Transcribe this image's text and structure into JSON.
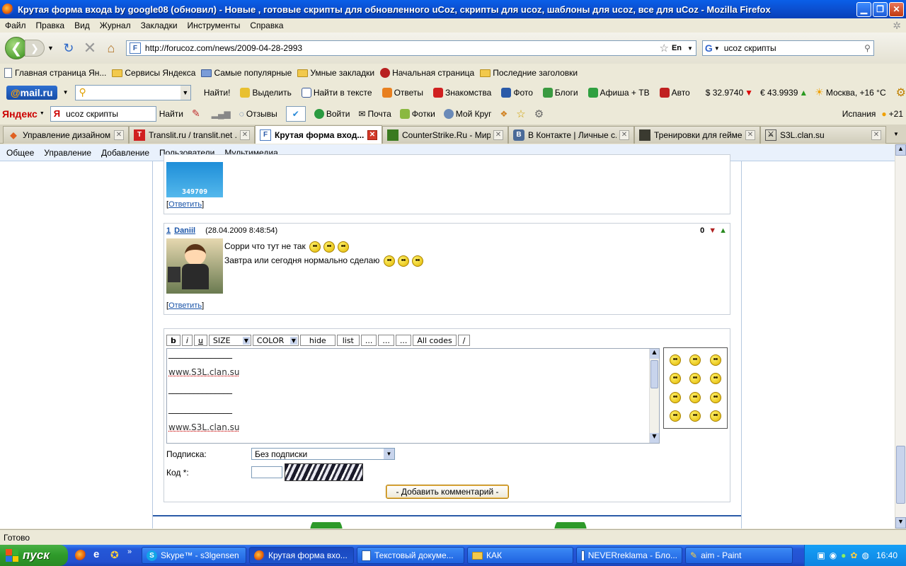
{
  "window": {
    "title": "Крутая форма входа by google08 (обновил) - Новые , готовые скрипты для обновленного uCoz, скрипты для ucoz, шаблоны для ucoz, все для uCoz - Mozilla Firefox"
  },
  "menu": [
    "Файл",
    "Правка",
    "Вид",
    "Журнал",
    "Закладки",
    "Инструменты",
    "Справка"
  ],
  "nav": {
    "url": "http://forucoz.com/news/2009-04-28-2993",
    "lang_badge": "En",
    "search_value": "ucoz скрипты"
  },
  "bookmarks": [
    "Главная страница Ян...",
    "Сервисы Яндекса",
    "Самые популярные",
    "Умные закладки",
    "Начальная страница",
    "Последние заголовки"
  ],
  "mailbar": {
    "logo_prefix": "@",
    "logo_text": "mail.ru",
    "find_label": "Найти!",
    "items": [
      "Выделить",
      "Найти в тексте",
      "Ответы",
      "Знакомства",
      "Фото",
      "Блоги",
      "Афиша + ТВ",
      "Авто"
    ],
    "usd": "$ 32.9740",
    "eur": "€ 43.9939",
    "weather": "Москва, +16 °C"
  },
  "yabar": {
    "logo": "Яндекс",
    "search_value": "ucoz скрипты",
    "find_label": "Найти",
    "reviews_label": "Отзывы",
    "items": [
      "Войти",
      "Почта",
      "Фотки",
      "Мой Круг"
    ],
    "region": "Испания",
    "temp": "+21"
  },
  "tabs": [
    {
      "label": "Управление дизайном ...",
      "active": false
    },
    {
      "label": "Translit.ru / translit.net ...",
      "active": false
    },
    {
      "label": "Крутая форма вход...",
      "active": true
    },
    {
      "label": "CounterStrike.Ru - Мир ...",
      "active": false
    },
    {
      "label": "В Контакте | Личные с...",
      "active": false
    },
    {
      "label": "Тренировки для гейме...",
      "active": false
    },
    {
      "label": "S3L.clan.su",
      "active": false
    }
  ],
  "ucoz_menu": [
    "Общее",
    "Управление",
    "Добавление",
    "Пользователи",
    "Мультимедиа"
  ],
  "comments": {
    "prev_counter": "349709",
    "reply_label": "Ответить",
    "comment": {
      "num": "1",
      "author": "Daniil",
      "date": "(28.04.2009 8:48:54)",
      "rating": "0",
      "line1": "Сорри что тут не так",
      "line2": "Завтра или сегодня нормально сделаю"
    }
  },
  "form": {
    "bb_buttons": [
      "b",
      "i",
      "u"
    ],
    "size_select": "SIZE",
    "color_select": "COLOR",
    "bb_buttons2": [
      "hide",
      "list",
      "...",
      "...",
      "...",
      "All codes",
      "/"
    ],
    "editor_lines": [
      "_______________",
      "www.S3L.clan.su",
      "_______________",
      "_______________",
      "www.S3L.clan.su"
    ],
    "subscribe_label": "Подписка:",
    "subscribe_value": "Без подписки",
    "code_label": "Код *:",
    "submit_label": "- Добавить комментарий -"
  },
  "status": "Готово",
  "taskbar": {
    "start": "пуск",
    "tasks": [
      "Skype™ - s3lgensen",
      "Крутая форма вхо...",
      "Текстовый докуме...",
      "КАК",
      "NEVERreklama - Бло...",
      "aim - Paint"
    ],
    "clock": "16:40"
  }
}
